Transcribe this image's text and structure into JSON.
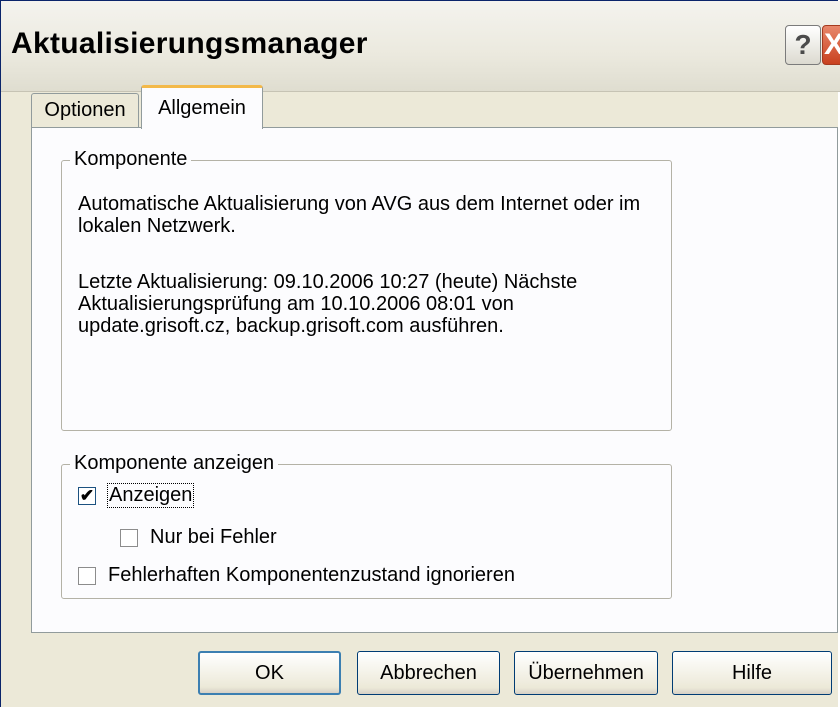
{
  "window": {
    "title": "Aktualisierungsmanager",
    "help_glyph": "?",
    "close_glyph": "X"
  },
  "tabs": [
    {
      "label": "Optionen",
      "selected": false
    },
    {
      "label": "Allgemein",
      "selected": true
    }
  ],
  "component_group": {
    "legend": "Komponente",
    "description": "Automatische Aktualisierung von AVG aus dem Internet oder im lokalen Netzwerk.",
    "update_info": "Letzte Aktualisierung: 09.10.2006 10:27 (heute) Nächste Aktualisierungsprüfung am 10.10.2006 08:01 von update.grisoft.cz, backup.grisoft.com ausführen."
  },
  "display_group": {
    "legend": "Komponente anzeigen",
    "options": [
      {
        "label": "Anzeigen",
        "checked": true
      },
      {
        "label": "Nur bei Fehler",
        "checked": false
      },
      {
        "label": "Fehlerhaften Komponentenzustand ignorieren",
        "checked": false
      }
    ]
  },
  "buttons": {
    "ok": "OK",
    "cancel": "Abbrechen",
    "apply": "Übernehmen",
    "help": "Hilfe"
  },
  "icons": {
    "help": "question-mark-icon",
    "close": "close-x-icon",
    "check": "checkmark-icon"
  },
  "colors": {
    "face": "#ece9d8",
    "panel": "#fcfcfe",
    "close_button": "#c9411f",
    "tab_highlight": "#f3b94a"
  }
}
